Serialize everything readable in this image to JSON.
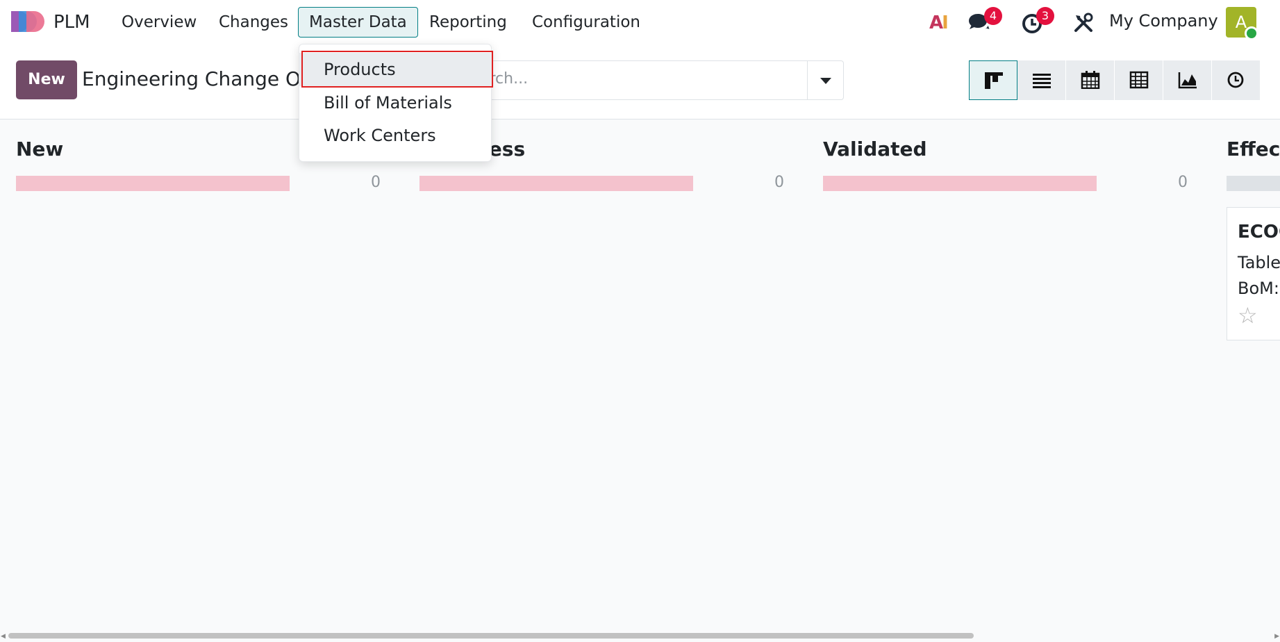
{
  "navbar": {
    "app_name": "PLM",
    "menu": [
      "Overview",
      "Changes",
      "Master Data",
      "Reporting",
      "Configuration"
    ],
    "ai_label": "AI",
    "messages_badge": "4",
    "activities_badge": "3",
    "company": "My Company",
    "avatar_initial": "A"
  },
  "control_panel": {
    "new_label": "New",
    "breadcrumb": "Engineering Change Or",
    "search_placeholder": "arch..."
  },
  "dropdown": {
    "items": [
      "Products",
      "Bill of Materials",
      "Work Centers"
    ]
  },
  "kanban": {
    "columns": [
      {
        "title": "New",
        "count": "0"
      },
      {
        "title": "ress",
        "count": "0"
      },
      {
        "title": "Validated",
        "count": "0"
      },
      {
        "title": "Effect",
        "count": ""
      }
    ],
    "card": {
      "title": "ECOO",
      "line1": "Table",
      "line2": "BoM:"
    }
  },
  "icons": {
    "view_switcher": [
      "kanban-icon",
      "list-icon",
      "calendar-icon",
      "pivot-icon",
      "graph-icon",
      "activity-icon"
    ]
  },
  "colors": {
    "primary": "#714b67",
    "accent": "#017e84",
    "progress": "#f4c2cd",
    "badge": "#e3113e",
    "focus_ring": "#e02020"
  }
}
